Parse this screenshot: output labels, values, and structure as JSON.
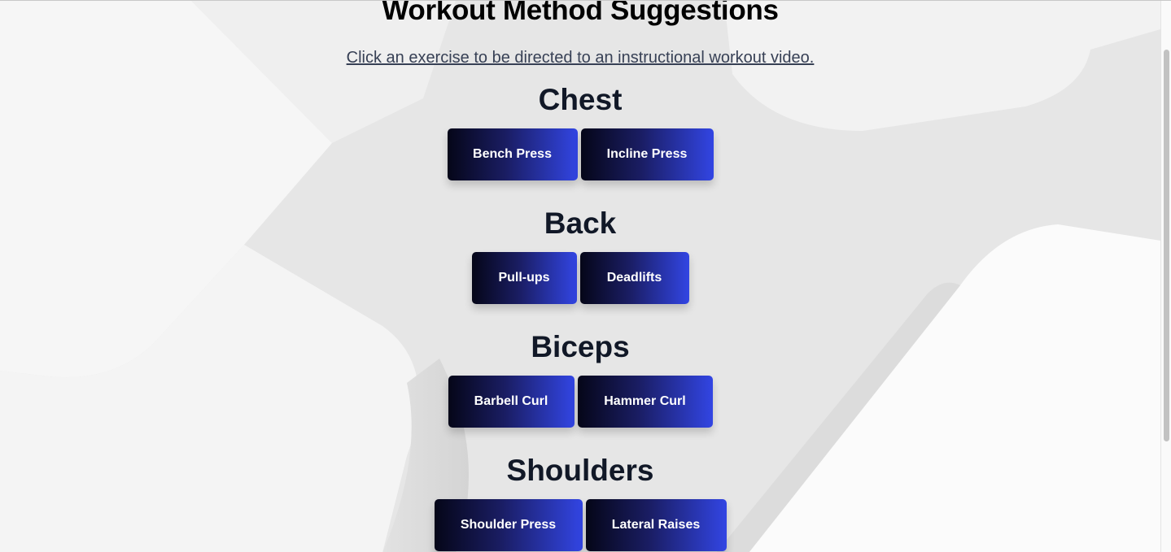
{
  "header": {
    "title": "Workout Method Suggestions",
    "subtitle": "Click an exercise to be directed to an instructional workout video."
  },
  "sections": [
    {
      "title": "Chest",
      "exercises": [
        "Bench Press",
        "Incline Press"
      ]
    },
    {
      "title": "Back",
      "exercises": [
        "Pull-ups",
        "Deadlifts"
      ]
    },
    {
      "title": "Biceps",
      "exercises": [
        "Barbell Curl",
        "Hammer Curl"
      ]
    },
    {
      "title": "Shoulders",
      "exercises": [
        "Shoulder Press",
        "Lateral Raises"
      ]
    }
  ],
  "colors": {
    "button_gradient_start": "#050618",
    "button_gradient_end": "#3245e3",
    "heading": "#111827",
    "background": "#e9e9e9"
  }
}
